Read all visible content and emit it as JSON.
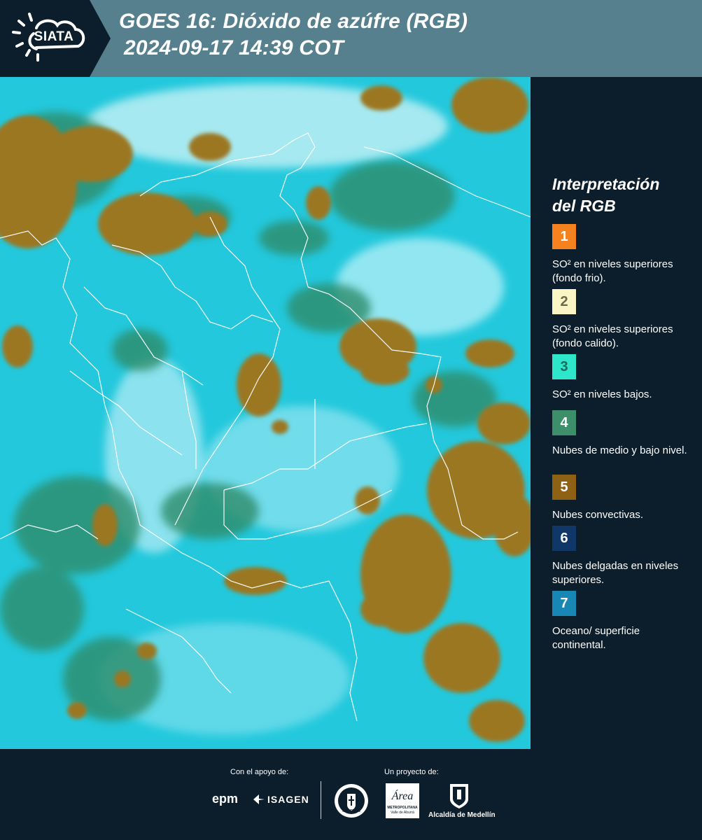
{
  "header": {
    "logo_text": "SIATA",
    "title_line1": "GOES 16: Dióxido de azúfre (RGB)",
    "title_line2": "2024-09-17 14:39 COT",
    "logo_icon": "sun-logo-icon",
    "colors": {
      "header_bg": "#57808f",
      "logo_bg": "#0c1d2b"
    }
  },
  "map": {
    "icon": "satellite-image",
    "colors": {
      "surface": "#23c8dc",
      "convective": "#9b7724",
      "mid_low": "#2f8c6b",
      "borders": "#ffffff"
    }
  },
  "legend": {
    "title_line1": "Interpretación",
    "title_line2": "del RGB",
    "items": [
      {
        "num": "1",
        "color": "#f5821f",
        "text_color": "#ffffff",
        "text": "SO² en niveles superiores (fondo frio)."
      },
      {
        "num": "2",
        "color": "#fbf4c4",
        "text_color": "#6a6a4a",
        "text": "SO² en niveles superiores (fondo calido)."
      },
      {
        "num": "3",
        "color": "#2ee6c9",
        "text_color": "#1f6a5c",
        "text": "SO² en niveles bajos."
      },
      {
        "num": "4",
        "color": "#3c8f6a",
        "text_color": "#ffffff",
        "text": "Nubes de medio y bajo nivel."
      },
      {
        "num": "5",
        "color": "#8f6115",
        "text_color": "#ffffff",
        "text": "Nubes convectivas."
      },
      {
        "num": "6",
        "color": "#0f3869",
        "text_color": "#ffffff",
        "text": "Nubes delgadas en niveles superiores."
      },
      {
        "num": "7",
        "color": "#1987b3",
        "text_color": "#ffffff",
        "text": "Oceano/ superficie continental."
      }
    ]
  },
  "footer": {
    "support_label": "Con el apoyo de:",
    "project_label": "Un proyecto de:",
    "epm": "epm",
    "isagen": "ISAGEN",
    "area_title": "Área",
    "area_sub1": "METROPOLITANA",
    "area_sub2": "Valle de Aburrá",
    "alcaldia": "Alcaldía de Medellín",
    "medellin_seal": "MEDELLÍN"
  }
}
